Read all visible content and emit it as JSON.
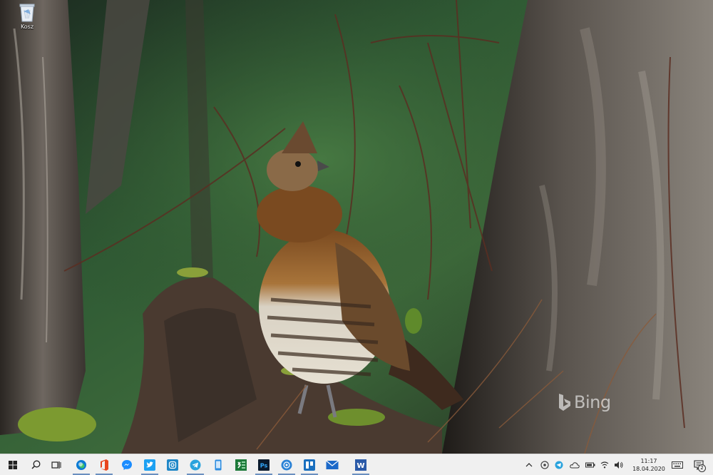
{
  "desktop": {
    "icons": [
      {
        "label": "Kosz",
        "icon": "recycle-bin-icon"
      }
    ],
    "watermark": "Bing"
  },
  "taskbar": {
    "start": {
      "icon": "windows-logo-icon"
    },
    "search": {
      "icon": "search-icon"
    },
    "task_view": {
      "icon": "task-view-icon"
    },
    "apps": [
      {
        "name": "edge",
        "icon": "edge-icon",
        "color": "#0c7bd4",
        "running": true
      },
      {
        "name": "office",
        "icon": "office-icon",
        "color": "#e8461e",
        "running": true
      },
      {
        "name": "messenger",
        "icon": "messenger-icon",
        "color": "#1a8cff",
        "running": false
      },
      {
        "name": "twitter",
        "icon": "twitter-icon",
        "color": "#1da1f2",
        "running": true
      },
      {
        "name": "instagram",
        "icon": "instagram-icon",
        "color": "#1f87c7",
        "running": false
      },
      {
        "name": "telegram",
        "icon": "telegram-icon",
        "color": "#2aa3dd",
        "running": true
      },
      {
        "name": "phone",
        "icon": "phone-icon",
        "color": "#2a8be0",
        "running": false
      },
      {
        "name": "excel",
        "icon": "excel-icon",
        "color": "#1d7a3a",
        "running": false
      },
      {
        "name": "photoshop",
        "label": "Ps",
        "icon": "photoshop-icon",
        "color": "#0a1b2e",
        "running": true
      },
      {
        "name": "store",
        "icon": "store-icon",
        "color": "#2b82d6",
        "running": true
      },
      {
        "name": "trello",
        "icon": "trello-icon",
        "color": "#1a6fbf",
        "running": true
      },
      {
        "name": "mail",
        "icon": "mail-icon",
        "color": "#1c69c9",
        "running": false
      },
      {
        "name": "word",
        "label": "W",
        "icon": "word-icon",
        "color": "#2b5aa8",
        "running": true
      }
    ],
    "tray": {
      "icons": [
        "chevron-up-icon",
        "vpn-icon",
        "telegram-tray-icon",
        "onedrive-icon",
        "battery-icon",
        "wifi-icon",
        "volume-icon",
        "keyboard-icon"
      ],
      "time": "11:17",
      "date": "18.04.2020",
      "notifications": "2"
    }
  }
}
